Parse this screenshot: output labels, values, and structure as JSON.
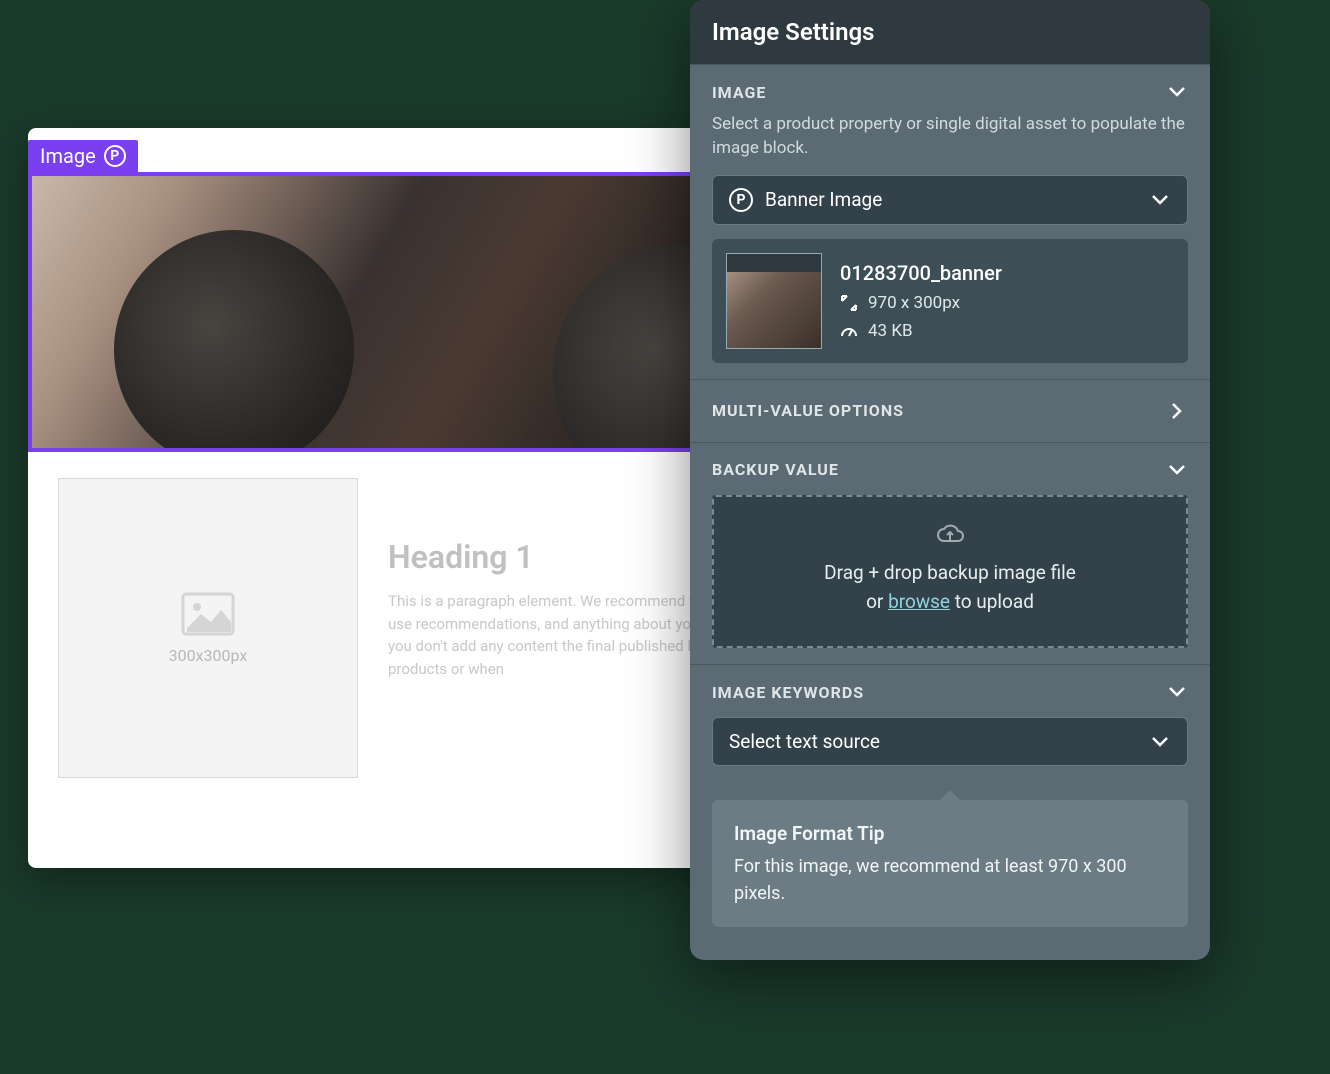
{
  "canvas": {
    "block_label": "Image",
    "placeholder_dim": "300x300px",
    "heading": "Heading 1",
    "paragraph": "This is a paragraph element. We recommend filling copy, specs, use recommendations, and anything about your great product. If you don't add any content the final published layout for your products or when"
  },
  "panel": {
    "title": "Image Settings",
    "sections": {
      "image": {
        "label": "IMAGE",
        "description": "Select a product property or single digital asset to populate the image block.",
        "dropdown_value": "Banner Image",
        "asset": {
          "name": "01283700_banner",
          "dimensions": "970 x 300px",
          "filesize": "43 KB"
        }
      },
      "multi": {
        "label": "MULTI-VALUE OPTIONS"
      },
      "backup": {
        "label": "BACKUP VALUE",
        "dropzone_line1": "Drag + drop backup image file",
        "dropzone_or": "or ",
        "dropzone_browse": "browse",
        "dropzone_suffix": " to upload"
      },
      "keywords": {
        "label": "IMAGE KEYWORDS",
        "dropdown_value": "Select text source"
      }
    },
    "tip": {
      "title": "Image Format Tip",
      "body": "For this image, we recommend at least 970 x 300 pixels."
    }
  }
}
